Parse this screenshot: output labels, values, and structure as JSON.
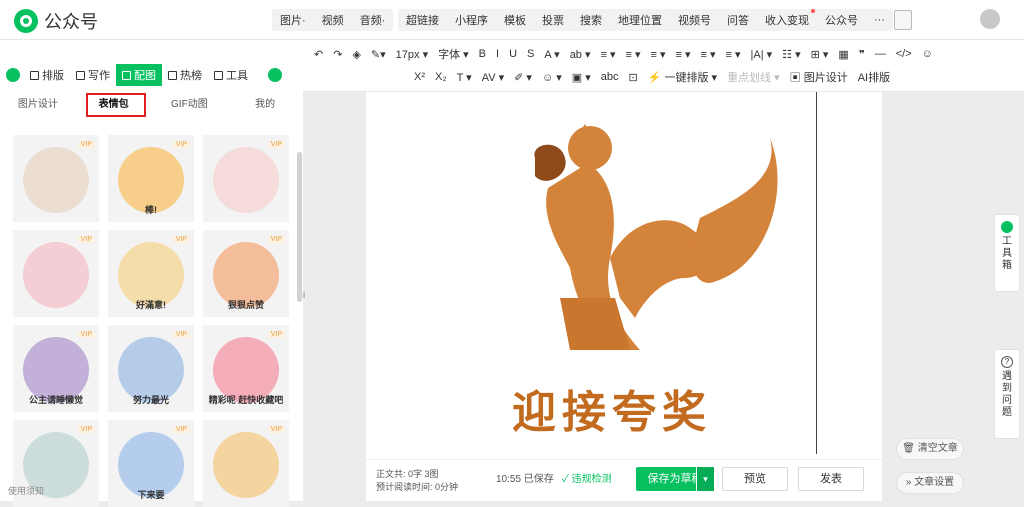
{
  "app": {
    "name": "公众号"
  },
  "insert_menu": {
    "items": [
      "图片·",
      "视频",
      "音频·"
    ]
  },
  "feature_menu": {
    "items": [
      "超链接",
      "小程序",
      "模板",
      "投票",
      "搜索",
      "地理位置",
      "视频号",
      "问答",
      "收入变现",
      "公众号",
      "···"
    ],
    "dot_item": "收入变现"
  },
  "format_toolbar": {
    "row1": [
      "↶",
      "↷",
      "◈",
      "✎▾",
      "17px ▾",
      "字体 ▾",
      "B",
      "I",
      "U",
      "S",
      "A ▾",
      "ab ▾",
      "≡ ▾",
      "≡ ▾",
      "≡ ▾",
      "≡ ▾",
      "≡ ▾",
      "≡ ▾",
      "|A| ▾",
      "☷ ▾",
      "⊞ ▾",
      "▦",
      "❞",
      "—",
      "</>",
      "☺"
    ],
    "row2": [
      "X²",
      "X₂",
      "T ▾",
      "AV ▾",
      "✐ ▾",
      "☺ ▾",
      "▣ ▾",
      "abc",
      "⊡",
      "⚡ 一键排版 ▾",
      "重点划线 ▾",
      "▣ 图片设计",
      "AI排版"
    ],
    "ai_label": "AI排版"
  },
  "left_tabs": {
    "items": [
      "排版",
      "写作",
      "配图",
      "热榜",
      "工具"
    ],
    "active": "配图"
  },
  "sub_tabs": {
    "items": [
      "图片设计",
      "表情包",
      "GIF动图",
      "我的"
    ],
    "active": "表情包"
  },
  "stickers": [
    {
      "name": "goat",
      "color": "#e9d9c9",
      "caption": ""
    },
    {
      "name": "kids-bang",
      "color": "#f7c777",
      "caption": "棒!"
    },
    {
      "name": "bunny",
      "color": "#f6d6d6",
      "caption": ""
    },
    {
      "name": "pig",
      "color": "#f3c5cf",
      "caption": ""
    },
    {
      "name": "catgirl",
      "color": "#f5d89c",
      "caption": "好滿意!"
    },
    {
      "name": "dancer",
      "color": "#f4b48a",
      "caption": "狠狠点赞"
    },
    {
      "name": "purple-girl",
      "color": "#b9a3d2",
      "caption": "公主请睡懒觉"
    },
    {
      "name": "boy-blue",
      "color": "#a9c4e6",
      "caption": "努力最光"
    },
    {
      "name": "pink-girl",
      "color": "#f5a0ae",
      "caption": "精彩呢 赶快收藏吧"
    },
    {
      "name": "fisher",
      "color": "#c6d8d6",
      "caption": ""
    },
    {
      "name": "blue-kid",
      "color": "#a8c6ea",
      "caption": "下来要"
    },
    {
      "name": "balloon",
      "color": "#f3cf8f",
      "caption": ""
    }
  ],
  "usage_tip": "使用须知",
  "editor": {
    "headline": "迎接夸奖"
  },
  "status": {
    "word_count": "正文共: 0字 3图",
    "read_time": "预计阅读时间: 0分钟",
    "saved": "10:55 已保存",
    "check": "违规检测"
  },
  "actions": {
    "save": "保存为草稿",
    "preview": "预览",
    "publish": "发表"
  },
  "side_tools": {
    "toolbox": "工具箱",
    "help": "遇到问题"
  },
  "right_buttons": {
    "clear": "清空文章",
    "settings": "文章设置"
  },
  "colors": {
    "accent": "#07c160",
    "squirrel": "#d4833a",
    "headline": "#c26a1e",
    "highlight": "#e02020"
  }
}
